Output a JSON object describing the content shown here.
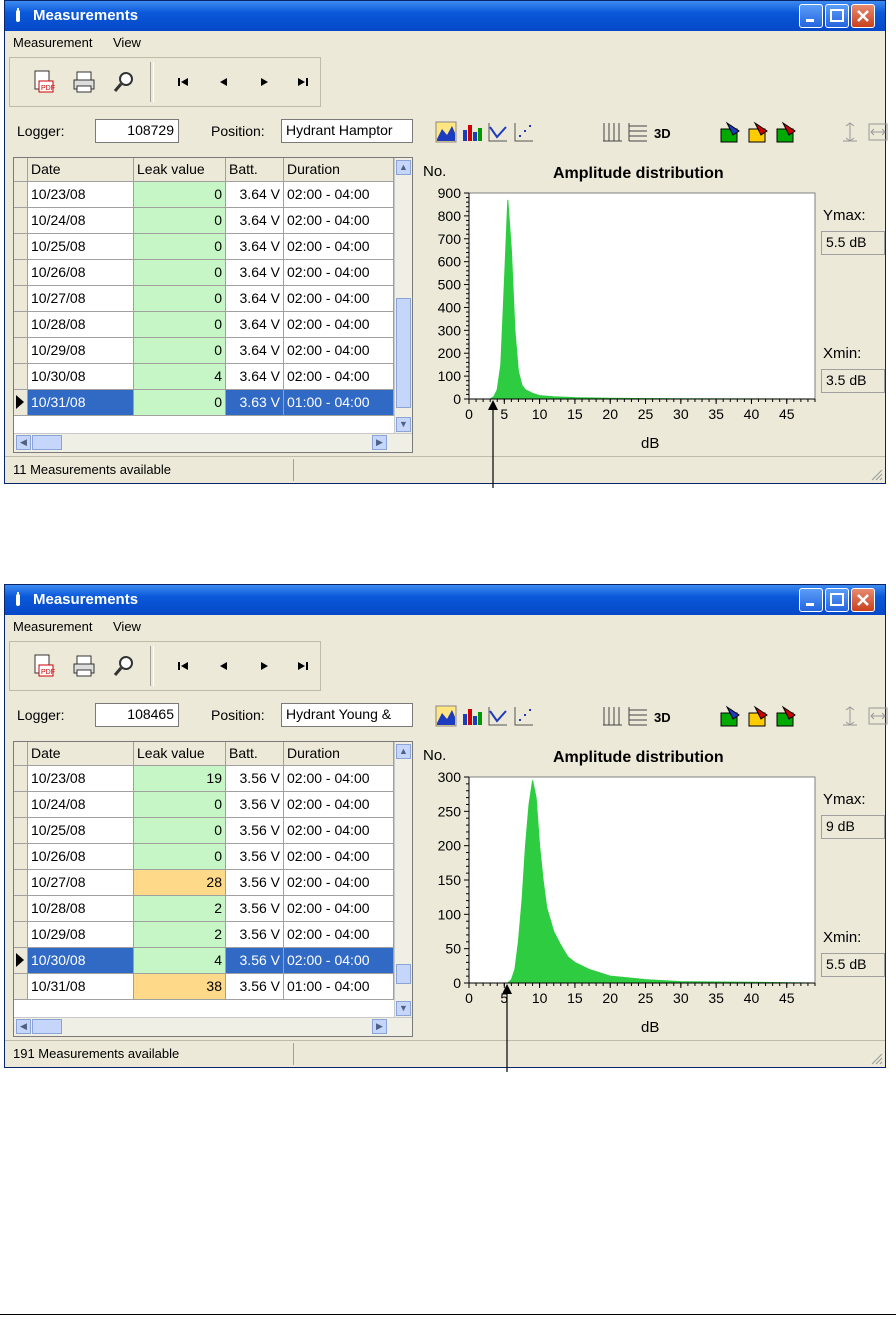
{
  "windows": [
    {
      "title": "Measurements",
      "menu": [
        "Measurement",
        "View"
      ],
      "logger_label": "Logger:",
      "logger_value": "108729",
      "position_label": "Position:",
      "position_value": "Hydrant Hamptor",
      "columns": [
        "Date",
        "Leak value",
        "Batt.",
        "Duration"
      ],
      "rows": [
        {
          "date": "10/23/08",
          "leak": "0",
          "batt": "3.64 V",
          "duration": "02:00 - 04:00",
          "level": "green"
        },
        {
          "date": "10/24/08",
          "leak": "0",
          "batt": "3.64 V",
          "duration": "02:00 - 04:00",
          "level": "green"
        },
        {
          "date": "10/25/08",
          "leak": "0",
          "batt": "3.64 V",
          "duration": "02:00 - 04:00",
          "level": "green"
        },
        {
          "date": "10/26/08",
          "leak": "0",
          "batt": "3.64 V",
          "duration": "02:00 - 04:00",
          "level": "green"
        },
        {
          "date": "10/27/08",
          "leak": "0",
          "batt": "3.64 V",
          "duration": "02:00 - 04:00",
          "level": "green"
        },
        {
          "date": "10/28/08",
          "leak": "0",
          "batt": "3.64 V",
          "duration": "02:00 - 04:00",
          "level": "green"
        },
        {
          "date": "10/29/08",
          "leak": "0",
          "batt": "3.64 V",
          "duration": "02:00 - 04:00",
          "level": "green"
        },
        {
          "date": "10/30/08",
          "leak": "4",
          "batt": "3.64 V",
          "duration": "02:00 - 04:00",
          "level": "green"
        },
        {
          "date": "10/31/08",
          "leak": "0",
          "batt": "3.63 V",
          "duration": "01:00 - 04:00",
          "level": "green",
          "selected": true
        }
      ],
      "status": "11 Measurements available",
      "ymax_label": "Ymax:",
      "ymax_value": "5.5 dB",
      "xmin_label": "Xmin:",
      "xmin_value": "3.5 dB",
      "chart_data": {
        "type": "area",
        "title": "Amplitude distribution",
        "ylabel": "No.",
        "xlabel": "dB",
        "xlim": [
          0,
          49
        ],
        "ylim": [
          0,
          900
        ],
        "xticks": [
          0,
          5,
          10,
          15,
          20,
          25,
          30,
          35,
          40,
          45
        ],
        "yticks": [
          0,
          100,
          200,
          300,
          400,
          500,
          600,
          700,
          800,
          900
        ],
        "color": "#2ecc40",
        "x": [
          0,
          3,
          3.5,
          4,
          4.5,
          5,
          5.5,
          6,
          6.5,
          7,
          7.5,
          8,
          9,
          10,
          12,
          15,
          20,
          30,
          49
        ],
        "y": [
          0,
          0,
          10,
          40,
          150,
          500,
          870,
          650,
          300,
          120,
          60,
          40,
          25,
          15,
          10,
          6,
          3,
          1,
          0
        ]
      }
    },
    {
      "title": "Measurements",
      "menu": [
        "Measurement",
        "View"
      ],
      "logger_label": "Logger:",
      "logger_value": "108465",
      "position_label": "Position:",
      "position_value": "Hydrant Young &",
      "columns": [
        "Date",
        "Leak value",
        "Batt.",
        "Duration"
      ],
      "rows": [
        {
          "date": "10/23/08",
          "leak": "19",
          "batt": "3.56 V",
          "duration": "02:00 - 04:00",
          "level": "green"
        },
        {
          "date": "10/24/08",
          "leak": "0",
          "batt": "3.56 V",
          "duration": "02:00 - 04:00",
          "level": "green"
        },
        {
          "date": "10/25/08",
          "leak": "0",
          "batt": "3.56 V",
          "duration": "02:00 - 04:00",
          "level": "green"
        },
        {
          "date": "10/26/08",
          "leak": "0",
          "batt": "3.56 V",
          "duration": "02:00 - 04:00",
          "level": "green"
        },
        {
          "date": "10/27/08",
          "leak": "28",
          "batt": "3.56 V",
          "duration": "02:00 - 04:00",
          "level": "orange"
        },
        {
          "date": "10/28/08",
          "leak": "2",
          "batt": "3.56 V",
          "duration": "02:00 - 04:00",
          "level": "green"
        },
        {
          "date": "10/29/08",
          "leak": "2",
          "batt": "3.56 V",
          "duration": "02:00 - 04:00",
          "level": "green"
        },
        {
          "date": "10/30/08",
          "leak": "4",
          "batt": "3.56 V",
          "duration": "02:00 - 04:00",
          "level": "green",
          "selected": true
        },
        {
          "date": "10/31/08",
          "leak": "38",
          "batt": "3.56 V",
          "duration": "01:00 - 04:00",
          "level": "orange"
        }
      ],
      "status": "191 Measurements available",
      "ymax_label": "Ymax:",
      "ymax_value": "9 dB",
      "xmin_label": "Xmin:",
      "xmin_value": "5.5 dB",
      "chart_data": {
        "type": "area",
        "title": "Amplitude distribution",
        "ylabel": "No.",
        "xlabel": "dB",
        "xlim": [
          0,
          49
        ],
        "ylim": [
          0,
          300
        ],
        "xticks": [
          0,
          5,
          10,
          15,
          20,
          25,
          30,
          35,
          40,
          45
        ],
        "yticks": [
          0,
          50,
          100,
          150,
          200,
          250,
          300
        ],
        "color": "#2ecc40",
        "x": [
          0,
          5.5,
          6,
          6.5,
          7,
          7.5,
          8,
          8.5,
          9,
          9.5,
          10,
          10.5,
          11,
          12,
          13,
          14,
          15,
          17,
          20,
          25,
          30,
          40,
          49
        ],
        "y": [
          0,
          0,
          5,
          20,
          60,
          120,
          200,
          260,
          295,
          270,
          200,
          150,
          110,
          75,
          55,
          38,
          30,
          20,
          10,
          5,
          2,
          1,
          0
        ]
      }
    }
  ],
  "colors": {
    "green_cell": "#c6f5c6",
    "orange_cell": "#ffd98a",
    "selection": "#316ac5",
    "chart_fill": "#2ecc40"
  }
}
